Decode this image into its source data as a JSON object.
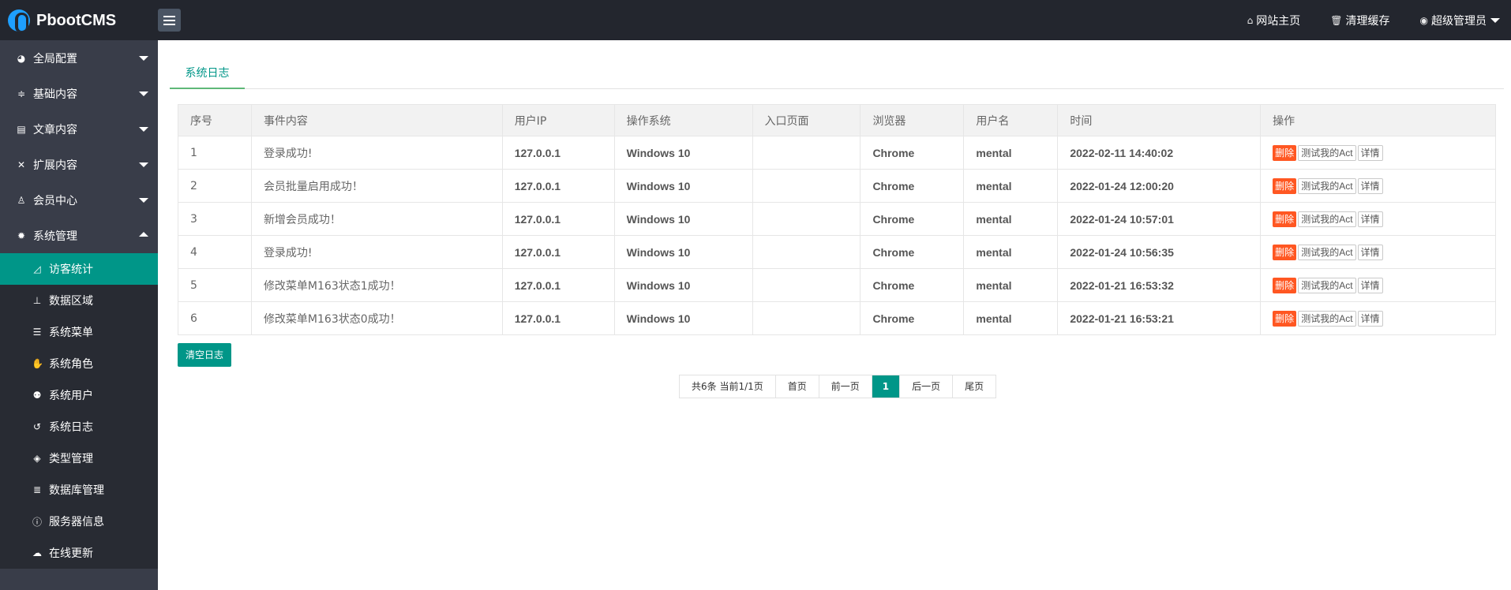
{
  "header": {
    "brand": "PbootCMS",
    "links": [
      {
        "icon": "home-icon",
        "glyph": "⌂",
        "label": "网站主页"
      },
      {
        "icon": "trash-icon",
        "glyph": "🗑",
        "label": "清理缓存"
      },
      {
        "icon": "user-circle-icon",
        "glyph": "◉",
        "label": "超级管理员"
      }
    ]
  },
  "sidebar": {
    "groups": [
      {
        "label": "全局配置",
        "icon": "globe-icon",
        "glyph": "◕"
      },
      {
        "label": "基础内容",
        "icon": "sliders-icon",
        "glyph": "≑"
      },
      {
        "label": "文章内容",
        "icon": "file-icon",
        "glyph": "▤"
      },
      {
        "label": "扩展内容",
        "icon": "expand-icon",
        "glyph": "✕"
      },
      {
        "label": "会员中心",
        "icon": "user-icon",
        "glyph": "♙"
      },
      {
        "label": "系统管理",
        "icon": "gear-icon",
        "glyph": "✹"
      }
    ],
    "subitems": [
      {
        "label": "访客统计",
        "icon": "area-chart-icon",
        "glyph": "◿",
        "active": true
      },
      {
        "label": "数据区域",
        "icon": "sitemap-icon",
        "glyph": "⊥"
      },
      {
        "label": "系统菜单",
        "icon": "list-icon",
        "glyph": "☰"
      },
      {
        "label": "系统角色",
        "icon": "hand-icon",
        "glyph": "✋"
      },
      {
        "label": "系统用户",
        "icon": "users-icon",
        "glyph": "⚉"
      },
      {
        "label": "系统日志",
        "icon": "history-icon",
        "glyph": "↺"
      },
      {
        "label": "类型管理",
        "icon": "tags-icon",
        "glyph": "◈"
      },
      {
        "label": "数据库管理",
        "icon": "database-icon",
        "glyph": "≣"
      },
      {
        "label": "服务器信息",
        "icon": "info-icon",
        "glyph": "ⓘ"
      },
      {
        "label": "在线更新",
        "icon": "cloud-download-icon",
        "glyph": "☁"
      }
    ]
  },
  "main": {
    "tab": "系统日志",
    "columns": [
      "序号",
      "事件内容",
      "用户IP",
      "操作系统",
      "入口页面",
      "浏览器",
      "用户名",
      "时间",
      "操作"
    ],
    "rows": [
      {
        "id": "1",
        "event": "登录成功!",
        "ip": "127.0.0.1",
        "os": "Windows 10",
        "entry": "",
        "browser": "Chrome",
        "user": "mental",
        "time": "2022-02-11 14:40:02"
      },
      {
        "id": "2",
        "event": "会员批量启用成功！",
        "ip": "127.0.0.1",
        "os": "Windows 10",
        "entry": "",
        "browser": "Chrome",
        "user": "mental",
        "time": "2022-01-24 12:00:20"
      },
      {
        "id": "3",
        "event": "新增会员成功！",
        "ip": "127.0.0.1",
        "os": "Windows 10",
        "entry": "",
        "browser": "Chrome",
        "user": "mental",
        "time": "2022-01-24 10:57:01"
      },
      {
        "id": "4",
        "event": "登录成功!",
        "ip": "127.0.0.1",
        "os": "Windows 10",
        "entry": "",
        "browser": "Chrome",
        "user": "mental",
        "time": "2022-01-24 10:56:35"
      },
      {
        "id": "5",
        "event": "修改菜单M163状态1成功！",
        "ip": "127.0.0.1",
        "os": "Windows 10",
        "entry": "",
        "browser": "Chrome",
        "user": "mental",
        "time": "2022-01-21 16:53:32"
      },
      {
        "id": "6",
        "event": "修改菜单M163状态0成功！",
        "ip": "127.0.0.1",
        "os": "Windows 10",
        "entry": "",
        "browser": "Chrome",
        "user": "mental",
        "time": "2022-01-21 16:53:21"
      }
    ],
    "actions": {
      "delete": "删除",
      "test": "测试我的Act",
      "detail": "详情"
    },
    "clear_button": "清空日志",
    "pager": {
      "summary": "共6条 当前1/1页",
      "first": "首页",
      "prev": "前一页",
      "current": "1",
      "next": "后一页",
      "last": "尾页"
    }
  },
  "colors": {
    "header_bg": "#23262e",
    "sidebar_bg": "#393d49",
    "submenu_bg": "#282b33",
    "accent": "#009688",
    "danger": "#ff5722"
  }
}
